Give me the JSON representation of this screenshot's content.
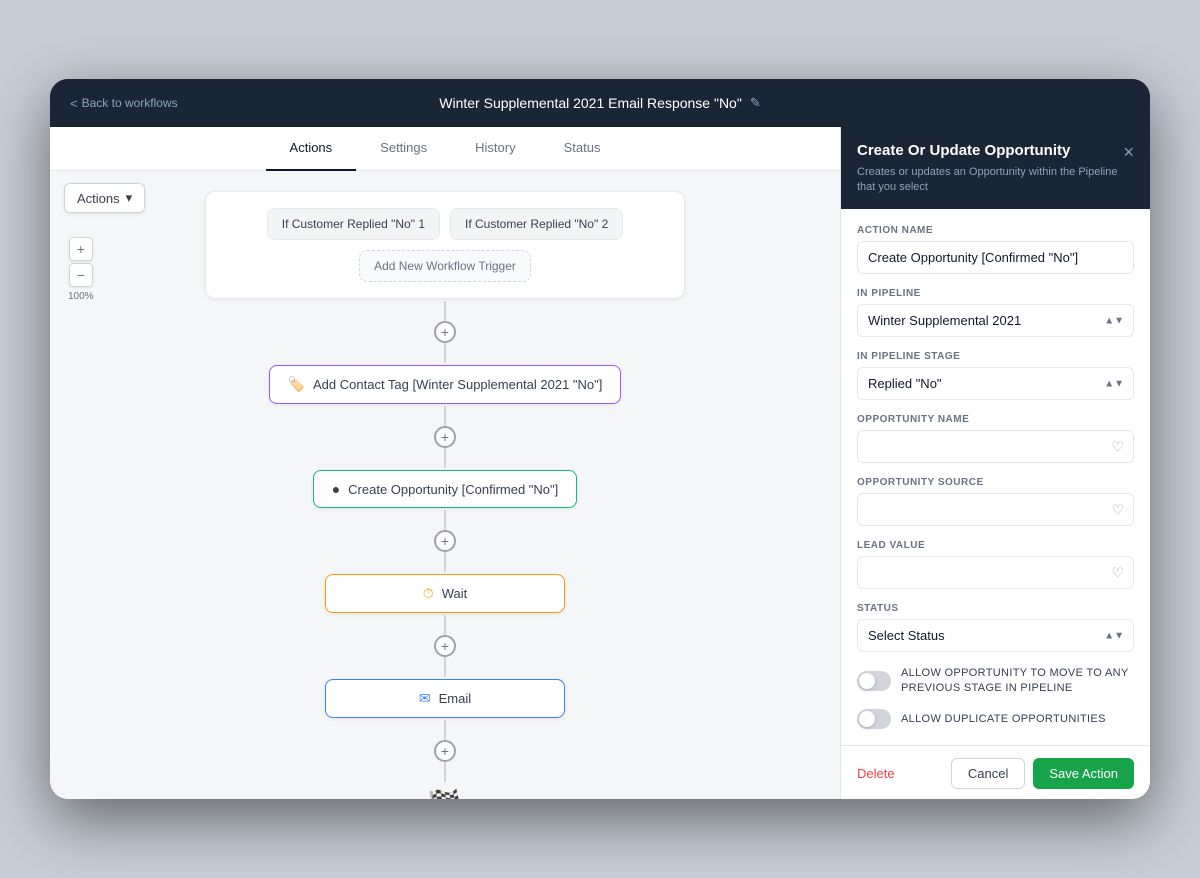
{
  "topbar": {
    "back_label": "Back to workflows",
    "title": "Winter Supplemental 2021 Email Response \"No\"",
    "edit_icon": "✎"
  },
  "tabs": [
    {
      "label": "Actions",
      "active": true
    },
    {
      "label": "Settings",
      "active": false
    },
    {
      "label": "History",
      "active": false
    },
    {
      "label": "Status",
      "active": false
    }
  ],
  "toolbar": {
    "actions_label": "Actions",
    "actions_arrow": "▾"
  },
  "zoom": {
    "plus": "+",
    "minus": "−",
    "level": "100%"
  },
  "canvas": {
    "trigger1_label": "If Customer Replied \"No\" 1",
    "trigger2_label": "If Customer Replied \"No\" 2",
    "add_trigger_label": "Add New Workflow Trigger",
    "node_tag_label": "Add Contact Tag [Winter Supplemental 2021 \"No\"]",
    "node_opportunity_label": "Create Opportunity [Confirmed \"No\"]",
    "node_wait_label": "Wait",
    "node_email_label": "Email",
    "finish_icon": "🏁"
  },
  "panel": {
    "title": "Create Or Update Opportunity",
    "subtitle": "Creates or updates an Opportunity within the Pipeline that you select",
    "close_icon": "×",
    "fields": {
      "action_name_label": "ACTION NAME",
      "action_name_value": "Create Opportunity [Confirmed \"No\"]",
      "in_pipeline_label": "IN PIPELINE",
      "in_pipeline_value": "Winter Supplemental 2021",
      "in_pipeline_stage_label": "IN PIPELINE STAGE",
      "in_pipeline_stage_value": "Replied \"No\"",
      "opportunity_name_label": "OPPORTUNITY NAME",
      "opportunity_name_placeholder": "",
      "opportunity_source_label": "OPPORTUNITY SOURCE",
      "opportunity_source_placeholder": "",
      "lead_value_label": "LEAD VALUE",
      "lead_value_placeholder": "",
      "status_label": "STATUS",
      "status_placeholder": "Select Status",
      "toggle1_label": "ALLOW OPPORTUNITY TO MOVE TO ANY PREVIOUS STAGE IN PIPELINE",
      "toggle2_label": "ALLOW DUPLICATE OPPORTUNITIES"
    },
    "footer": {
      "delete_label": "Delete",
      "cancel_label": "Cancel",
      "save_label": "Save Action"
    }
  }
}
